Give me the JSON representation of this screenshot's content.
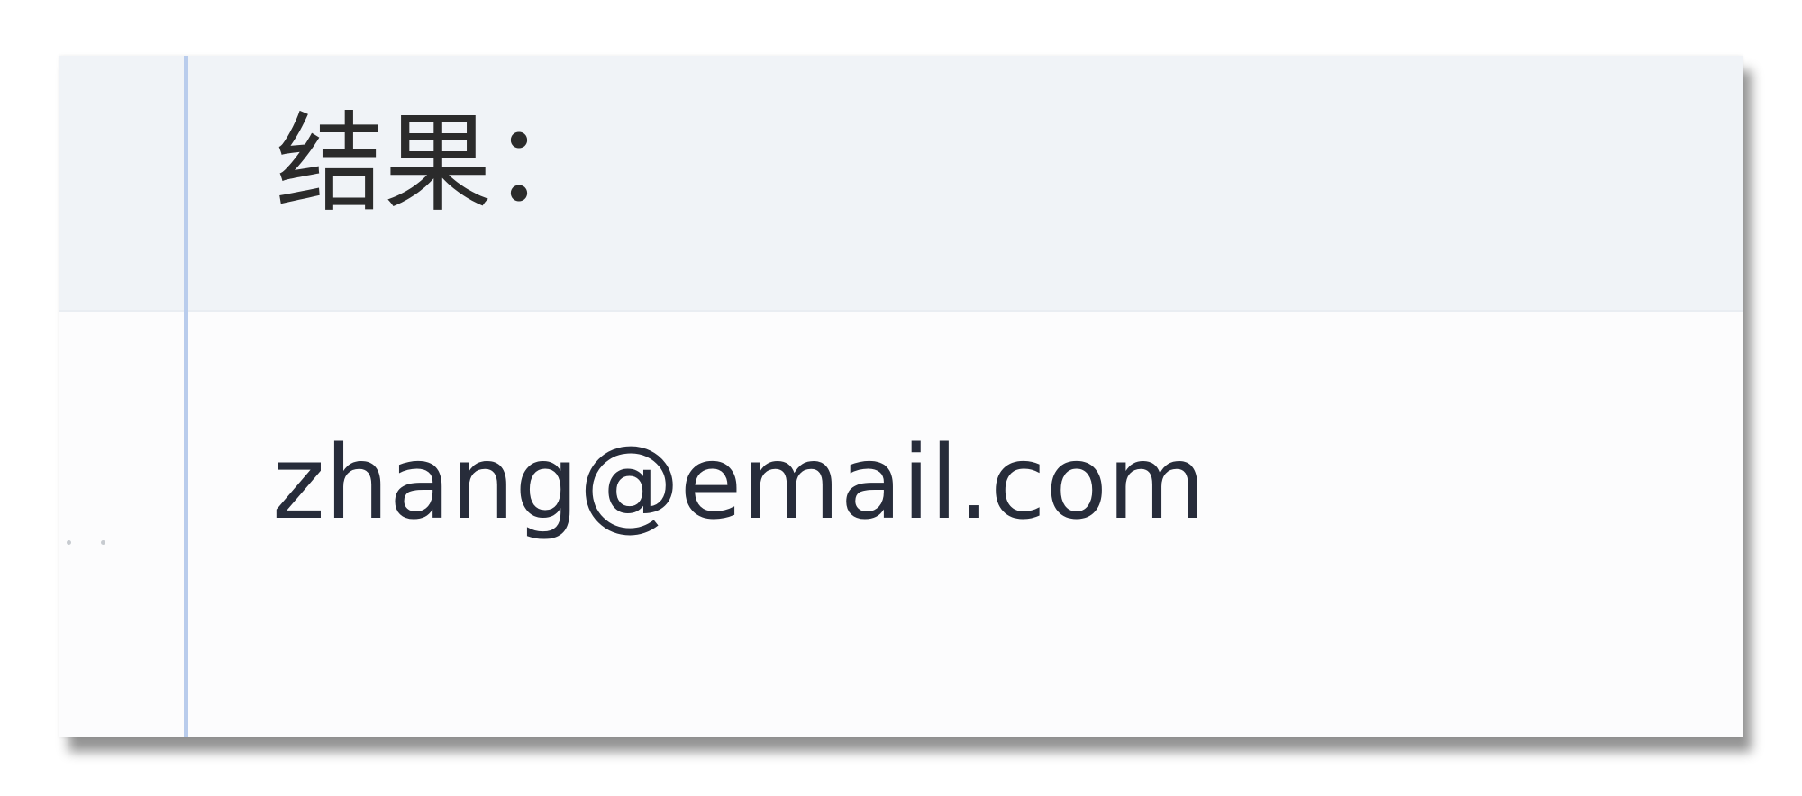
{
  "result": {
    "heading": "结果：",
    "value": "zhang@email.com"
  },
  "colors": {
    "divider": "#b9ccec",
    "header_background": "#f0f3f7",
    "text": "#2b2b2b",
    "value_text": "#272c3a"
  }
}
